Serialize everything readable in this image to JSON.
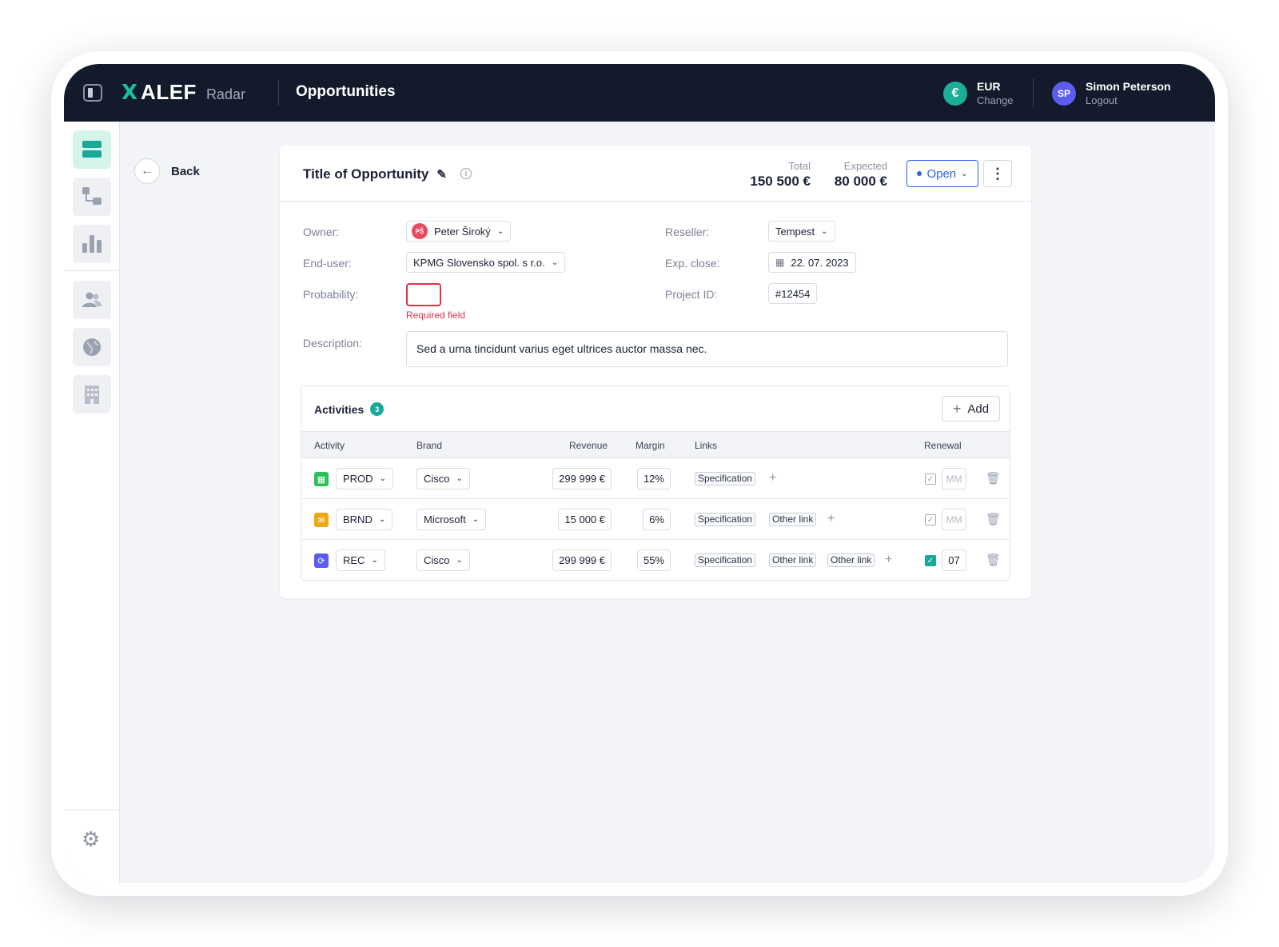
{
  "header": {
    "logo_mark": "X",
    "logo_text": "ALEF",
    "logo_sub": "Radar",
    "page_title": "Opportunities",
    "currency_symbol": "€",
    "currency_code": "EUR",
    "currency_action": "Change",
    "user_initials": "SP",
    "user_name": "Simon Peterson",
    "user_action": "Logout"
  },
  "back_label": "Back",
  "opportunity": {
    "title": "Title of Opportunity",
    "total_label": "Total",
    "total_value": "150 500 €",
    "expected_label": "Expected",
    "expected_value": "80 000 €",
    "status": "Open"
  },
  "fields": {
    "owner_label": "Owner:",
    "owner_initials": "PŠ",
    "owner_value": "Peter Široký",
    "enduser_label": "End-user:",
    "enduser_value": "KPMG Slovensko spol. s r.o.",
    "probability_label": "Probability:",
    "probability_error": "Required field",
    "reseller_label": "Reseller:",
    "reseller_value": "Tempest",
    "expclose_label": "Exp. close:",
    "expclose_value": "22. 07. 2023",
    "projectid_label": "Project ID:",
    "projectid_value": "#12454",
    "description_label": "Description:",
    "description_value": "Sed a urna tincidunt varius eget ultrices auctor massa nec."
  },
  "activities": {
    "title": "Activities",
    "count": "3",
    "add_label": "Add",
    "columns": [
      "Activity",
      "Brand",
      "Revenue",
      "Margin",
      "Links",
      "Renewal"
    ],
    "rows": [
      {
        "icon": "calendar-icon",
        "color": "#2fbf5a",
        "activity": "PROD",
        "brand": "Cisco",
        "revenue": "299 999 €",
        "margin": "12%",
        "links": [
          "Specification"
        ],
        "renewal_checked": false,
        "renewal_month": "MM"
      },
      {
        "icon": "megaphone-icon",
        "color": "#f0a818",
        "activity": "BRND",
        "brand": "Microsoft",
        "revenue": "15 000 €",
        "margin": "6%",
        "links": [
          "Specification",
          "Other link"
        ],
        "renewal_checked": false,
        "renewal_month": "MM"
      },
      {
        "icon": "repeat-icon",
        "color": "#5b5cf0",
        "activity": "REC",
        "brand": "Cisco",
        "revenue": "299 999 €",
        "margin": "55%",
        "links": [
          "Specification",
          "Other link",
          "Other link"
        ],
        "renewal_checked": true,
        "renewal_month": "07"
      }
    ]
  },
  "colors": {
    "topbar": "#121a2b",
    "accent": "#17a999",
    "primary_blue": "#2c63e0",
    "error": "#e0334a"
  }
}
